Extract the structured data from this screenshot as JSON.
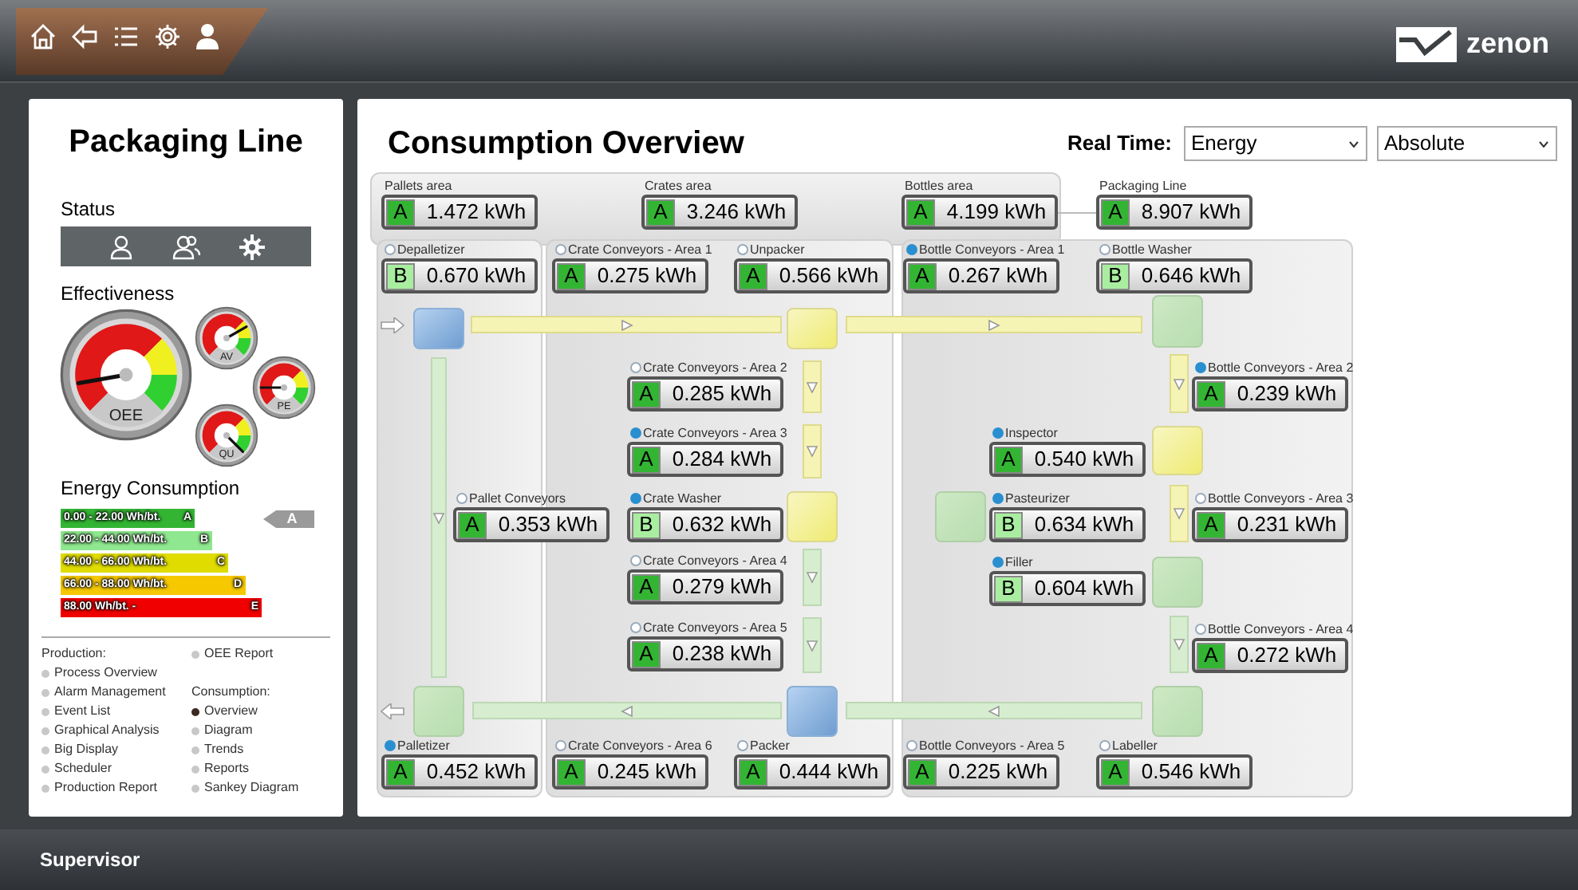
{
  "top_bar": {
    "logo": "zenon"
  },
  "left_panel": {
    "title": "Packaging Line",
    "status_heading": "Status",
    "effectiveness_heading": "Effectiveness",
    "gauges": [
      {
        "label": "OEE"
      },
      {
        "label": "AV"
      },
      {
        "label": "PE"
      },
      {
        "label": "QU"
      }
    ],
    "energy_heading": "Energy Consumption",
    "energy_classes": [
      {
        "range": "0.00 - 22.00 Wh/bt.",
        "grade": "A",
        "color": "#33b533"
      },
      {
        "range": "22.00 - 44.00 Wh/bt.",
        "grade": "B",
        "color": "#8fe88f"
      },
      {
        "range": "44.00 - 66.00 Wh/bt.",
        "grade": "C",
        "color": "#e0dc00"
      },
      {
        "range": "66.00 - 88.00 Wh/bt.",
        "grade": "D",
        "color": "#f5c800"
      },
      {
        "range": "88.00 Wh/bt. -",
        "grade": "E",
        "color": "#f00000"
      }
    ],
    "current_class": "A",
    "nav": [
      {
        "heading": "Production:",
        "items": [
          {
            "label": "Process Overview",
            "selected": false
          },
          {
            "label": "Alarm Management",
            "selected": false
          },
          {
            "label": "Event List",
            "selected": false
          },
          {
            "label": "Graphical Analysis",
            "selected": false
          },
          {
            "label": "Big Display",
            "selected": false
          },
          {
            "label": "Scheduler",
            "selected": false
          },
          {
            "label": "Production Report",
            "selected": false
          },
          {
            "label": "OEE Report",
            "selected": false
          }
        ]
      },
      {
        "heading": "Consumption:",
        "items": [
          {
            "label": "Overview",
            "selected": true
          },
          {
            "label": "Diagram",
            "selected": false
          },
          {
            "label": "Trends",
            "selected": false
          },
          {
            "label": "Reports",
            "selected": false
          },
          {
            "label": "Sankey Diagram",
            "selected": false
          }
        ]
      }
    ]
  },
  "main": {
    "title": "Consumption Overview",
    "mode_label": "Real Time:",
    "quantity_select": "Energy",
    "scale_select": "Absolute",
    "nodes": [
      {
        "label": "Pallets area",
        "grade": "A",
        "color": "#33b533",
        "value": "1.472 kWh"
      },
      {
        "label": "Crates area",
        "grade": "A",
        "color": "#33b533",
        "value": "3.246 kWh"
      },
      {
        "label": "Bottles area",
        "grade": "A",
        "color": "#33b533",
        "value": "4.199 kWh"
      },
      {
        "label": "Packaging Line",
        "grade": "A",
        "color": "#33b533",
        "value": "8.907 kWh"
      },
      {
        "label": "Depalletizer",
        "active": false,
        "grade": "B",
        "color": "#a9eea0",
        "value": "0.670 kWh"
      },
      {
        "label": "Crate Conveyors - Area 1",
        "active": false,
        "grade": "A",
        "color": "#33b533",
        "value": "0.275 kWh"
      },
      {
        "label": "Unpacker",
        "active": false,
        "grade": "A",
        "color": "#33b533",
        "value": "0.566 kWh"
      },
      {
        "label": "Bottle Conveyors - Area 1",
        "active": true,
        "grade": "A",
        "color": "#33b533",
        "value": "0.267 kWh"
      },
      {
        "label": "Bottle Washer",
        "active": false,
        "grade": "B",
        "color": "#a9eea0",
        "value": "0.646 kWh"
      },
      {
        "label": "Crate Conveyors - Area 2",
        "active": false,
        "grade": "A",
        "color": "#33b533",
        "value": "0.285 kWh"
      },
      {
        "label": "Bottle Conveyors - Area 2",
        "active": true,
        "grade": "A",
        "color": "#33b533",
        "value": "0.239 kWh"
      },
      {
        "label": "Crate Conveyors - Area 3",
        "active": true,
        "grade": "A",
        "color": "#33b533",
        "value": "0.284 kWh"
      },
      {
        "label": "Inspector",
        "active": true,
        "grade": "A",
        "color": "#33b533",
        "value": "0.540 kWh"
      },
      {
        "label": "Pallet Conveyors",
        "active": false,
        "grade": "A",
        "color": "#33b533",
        "value": "0.353 kWh"
      },
      {
        "label": "Crate Washer",
        "active": true,
        "grade": "B",
        "color": "#a9eea0",
        "value": "0.632 kWh"
      },
      {
        "label": "Pasteurizer",
        "active": true,
        "grade": "B",
        "color": "#a9eea0",
        "value": "0.634 kWh"
      },
      {
        "label": "Bottle Conveyors - Area 3",
        "active": false,
        "grade": "A",
        "color": "#33b533",
        "value": "0.231 kWh"
      },
      {
        "label": "Crate Conveyors - Area 4",
        "active": false,
        "grade": "A",
        "color": "#33b533",
        "value": "0.279 kWh"
      },
      {
        "label": "Filler",
        "active": true,
        "grade": "B",
        "color": "#a9eea0",
        "value": "0.604 kWh"
      },
      {
        "label": "Crate Conveyors - Area 5",
        "active": false,
        "grade": "A",
        "color": "#33b533",
        "value": "0.238 kWh"
      },
      {
        "label": "Bottle Conveyors - Area 4",
        "active": false,
        "grade": "A",
        "color": "#33b533",
        "value": "0.272 kWh"
      },
      {
        "label": "Palletizer",
        "active": true,
        "grade": "A",
        "color": "#33b533",
        "value": "0.452 kWh"
      },
      {
        "label": "Crate Conveyors - Area 6",
        "active": false,
        "grade": "A",
        "color": "#33b533",
        "value": "0.245 kWh"
      },
      {
        "label": "Packer",
        "active": false,
        "grade": "A",
        "color": "#33b533",
        "value": "0.444 kWh"
      },
      {
        "label": "Bottle Conveyors - Area 5",
        "active": false,
        "grade": "A",
        "color": "#33b533",
        "value": "0.225 kWh"
      },
      {
        "label": "Labeller",
        "active": false,
        "grade": "A",
        "color": "#33b533",
        "value": "0.546 kWh"
      }
    ]
  },
  "status_bar": {
    "user": "Supervisor"
  }
}
